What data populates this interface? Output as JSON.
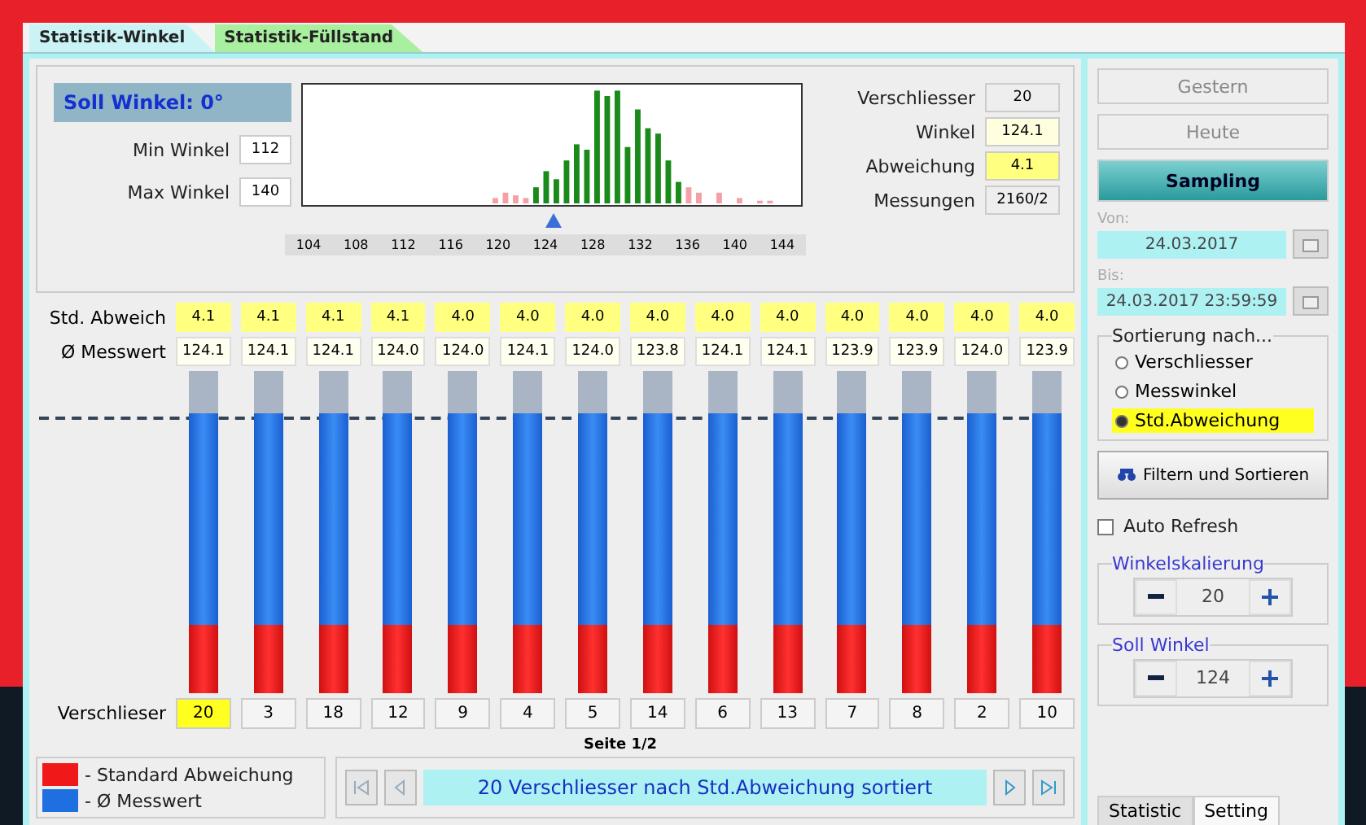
{
  "tabs": [
    {
      "label": "Statistik-Winkel",
      "selected": true
    },
    {
      "label": "Statistik-Füllstand",
      "selected": false
    }
  ],
  "soll_winkel": "Soll Winkel: 0°",
  "min_winkel": {
    "label": "Min Winkel",
    "value": "112"
  },
  "max_winkel": {
    "label": "Max Winkel",
    "value": "140"
  },
  "histogram": {
    "axis_labels": [
      "104",
      "108",
      "112",
      "116",
      "120",
      "124",
      "128",
      "132",
      "136",
      "140",
      "144"
    ]
  },
  "stats": [
    {
      "label": "Verschliesser",
      "value": "20",
      "kind": "plain"
    },
    {
      "label": "Winkel",
      "value": "124.1",
      "kind": "light"
    },
    {
      "label": "Abweichung",
      "value": "4.1",
      "kind": "yellow"
    },
    {
      "label": "Messungen",
      "value": "2160/2",
      "kind": "plain"
    }
  ],
  "row_labels": {
    "std": "Std. Abweich",
    "mean": "Ø Messwert",
    "id": "Verschlieser"
  },
  "closures": [
    {
      "std": "4.1",
      "mean": "124.1",
      "id": "20",
      "level": 0.87,
      "selected": true
    },
    {
      "std": "4.1",
      "mean": "124.1",
      "id": "3",
      "level": 0.87,
      "selected": false
    },
    {
      "std": "4.1",
      "mean": "124.1",
      "id": "18",
      "level": 0.87,
      "selected": false
    },
    {
      "std": "4.1",
      "mean": "124.0",
      "id": "12",
      "level": 0.87,
      "selected": false
    },
    {
      "std": "4.0",
      "mean": "124.0",
      "id": "9",
      "level": 0.87,
      "selected": false
    },
    {
      "std": "4.0",
      "mean": "124.1",
      "id": "4",
      "level": 0.87,
      "selected": false
    },
    {
      "std": "4.0",
      "mean": "124.0",
      "id": "5",
      "level": 0.87,
      "selected": false
    },
    {
      "std": "4.0",
      "mean": "123.8",
      "id": "14",
      "level": 0.87,
      "selected": false
    },
    {
      "std": "4.0",
      "mean": "124.1",
      "id": "6",
      "level": 0.87,
      "selected": false
    },
    {
      "std": "4.0",
      "mean": "124.1",
      "id": "13",
      "level": 0.87,
      "selected": false
    },
    {
      "std": "4.0",
      "mean": "123.9",
      "id": "7",
      "level": 0.87,
      "selected": false
    },
    {
      "std": "4.0",
      "mean": "123.9",
      "id": "8",
      "level": 0.87,
      "selected": false
    },
    {
      "std": "4.0",
      "mean": "124.0",
      "id": "2",
      "level": 0.87,
      "selected": false
    },
    {
      "std": "4.0",
      "mean": "123.9",
      "id": "10",
      "level": 0.87,
      "selected": false
    }
  ],
  "page": "Seite 1/2",
  "legend": [
    {
      "label": "- Standard Abweichung",
      "color": "#f01818"
    },
    {
      "label": "- Ø Messwert",
      "color": "#1e6fe0"
    }
  ],
  "status": "20 Verschliesser nach Std.Abweichung sortiert",
  "sidebar": {
    "buttons": [
      {
        "label": "Gestern",
        "selected": false
      },
      {
        "label": "Heute",
        "selected": false
      },
      {
        "label": "Sampling",
        "selected": true
      }
    ],
    "from": {
      "label": "Von:",
      "value": "24.03.2017"
    },
    "to": {
      "label": "Bis:",
      "value": "24.03.2017 23:59:59"
    },
    "sort": {
      "title": "Sortierung nach...",
      "options": [
        {
          "label": "Verschliesser",
          "selected": false
        },
        {
          "label": "Messwinkel",
          "selected": false
        },
        {
          "label": "Std.Abweichung",
          "selected": true
        }
      ]
    },
    "filter_button": "Filtern und Sortieren",
    "auto_refresh": {
      "label": "Auto Refresh",
      "checked": false
    },
    "steppers": [
      {
        "title": "Winkelskalierung",
        "value": "20"
      },
      {
        "title": "Soll Winkel",
        "value": "124"
      }
    ],
    "tabs": [
      {
        "label": "Statistic",
        "selected": false
      },
      {
        "label": "Setting",
        "selected": true
      }
    ]
  }
}
